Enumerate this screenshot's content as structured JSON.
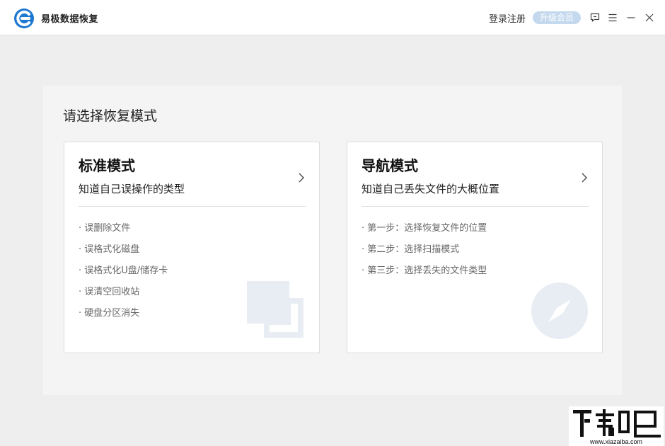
{
  "header": {
    "app_title": "易极数据恢复",
    "login_label": "登录注册",
    "upgrade_label": "升级会员",
    "icons": [
      "logo-icon",
      "feedback-icon",
      "menu-icon",
      "minimize-icon",
      "close-icon"
    ]
  },
  "main": {
    "title": "请选择恢复模式",
    "cards": [
      {
        "title": "标准模式",
        "subtitle": "知道自己误操作的类型",
        "items": [
          "· 误删除文件",
          "· 误格式化磁盘",
          "· 误格式化U盘/储存卡",
          "· 误清空回收站",
          "· 硬盘分区消失"
        ],
        "icon": "overlapping-squares-icon"
      },
      {
        "title": "导航模式",
        "subtitle": "知道自己丢失文件的大概位置",
        "items": [
          "· 第一步：选择恢复文件的位置",
          "· 第二步：选择扫描模式",
          "· 第三步：选择丢失的文件类型"
        ],
        "icon": "compass-icon"
      }
    ]
  },
  "colors": {
    "accent": "#1e78d2",
    "upgrade_bg": "#c4d9ee",
    "decor": "#e8edf3"
  }
}
